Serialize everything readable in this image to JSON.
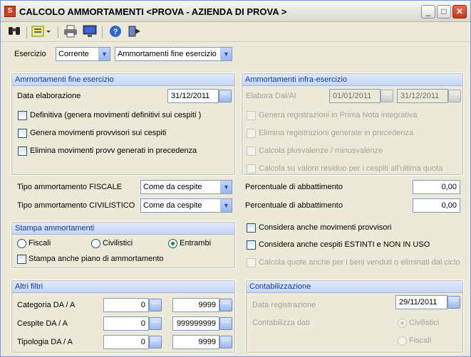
{
  "window": {
    "title": "CALCOLO AMMORTAMENTI <PROVA - AZIENDA DI PROVA >"
  },
  "toolbar": {
    "icons": [
      "binoculars-icon",
      "list-icon",
      "print-icon",
      "preview-icon",
      "help-icon",
      "exit-icon"
    ]
  },
  "esercizio": {
    "label": "Esercizio",
    "value": "Corrente",
    "tipo": "Ammortamenti fine esercizio"
  },
  "fine": {
    "header": "Ammortamenti fine esercizio",
    "data_label": "Data elaborazione",
    "data_value": "31/12/2011",
    "options": [
      "Definitiva (genera movimenti definitivi sui cespiti )",
      "Genera movimenti provvisori sui cespiti",
      "Elimina movimenti provv generati in precedenza"
    ]
  },
  "infra": {
    "header": "Ammortamenti infra-esercizio",
    "label": "Elabora Dal/Al",
    "dal": "01/01/2011",
    "al": "31/12/2011",
    "options": [
      "Genera registrazioni in Prima Nota integrativa",
      "Elimina registrazioni generate in precedenza",
      "Calcola plusvalenze / minusvalenze",
      "Calcola su valore residuo per i cespiti all'ultima quota"
    ]
  },
  "tipo": {
    "fiscale_label": "Tipo ammortamento FISCALE",
    "fiscale_value": "Come da cespite",
    "civilistico_label": "Tipo ammortamento CIVILISTICO",
    "civilistico_value": "Come da cespite",
    "perc_label": "Percentuale di abbattimento",
    "perc_fiscale": "0,00",
    "perc_civilistico": "0,00"
  },
  "stampa": {
    "header": "Stampa ammortamenti",
    "radios": [
      "Fiscali",
      "Civilistici",
      "Entrambi"
    ],
    "selected": "Entrambi",
    "piano": "Stampa anche piano di ammortamento"
  },
  "considera": {
    "provvisori": "Considera anche movimenti provvisori",
    "estinti": "Considera anche cespiti ESTINTI e NON IN USO",
    "venduti": "Calcola quote anche per i beni venduti o eliminati dal ciclo"
  },
  "filtri": {
    "header": "Altri filtri",
    "rows": [
      {
        "label": "Categoria DA / A",
        "da": "0",
        "a": "9999"
      },
      {
        "label": "Cespite DA / A",
        "da": "0",
        "a": "999999999"
      },
      {
        "label": "Tipologia DA / A",
        "da": "0",
        "a": "9999"
      }
    ]
  },
  "contab": {
    "header": "Contabilizzazione",
    "data_label": "Data registrazione",
    "data_value": "29/11/2011",
    "dati_label": "Contabilizza dati",
    "radios": [
      "Civilistici",
      "Fiscali"
    ],
    "selected": "Civilistici"
  }
}
